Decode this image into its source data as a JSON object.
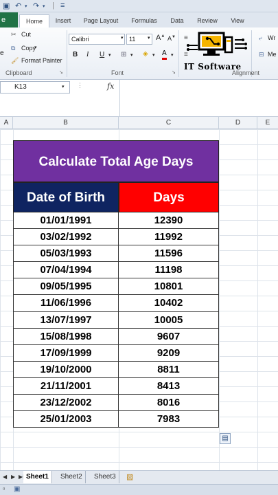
{
  "ribbon_tabs": {
    "file": "e",
    "home": "Home",
    "insert": "Insert",
    "page_layout": "Page Layout",
    "formulas": "Formulas",
    "data": "Data",
    "review": "Review",
    "view": "View"
  },
  "clipboard": {
    "cut": "Cut",
    "copy": "Copy",
    "format_painter": "Format Painter",
    "paste_partial": "e",
    "group_label": "Clipboard"
  },
  "font": {
    "family": "Calibri",
    "size": "11",
    "group_label": "Font",
    "bold": "B",
    "italic": "I",
    "underline": "U"
  },
  "alignment": {
    "wrap_partial": "Wr",
    "merge_partial": "Me",
    "group_label": "Alignment"
  },
  "logo": {
    "text": "IT Software"
  },
  "formula_bar": {
    "name_box": "K13",
    "fx": "fx"
  },
  "columns": [
    "A",
    "B",
    "C",
    "D",
    "E"
  ],
  "table": {
    "title": "Calculate Total Age Days",
    "header_dob": "Date of Birth",
    "header_days": "Days",
    "rows": [
      {
        "dob": "01/01/1991",
        "days": "12390"
      },
      {
        "dob": "03/02/1992",
        "days": "11992"
      },
      {
        "dob": "05/03/1993",
        "days": "11596"
      },
      {
        "dob": "07/04/1994",
        "days": "11198"
      },
      {
        "dob": "09/05/1995",
        "days": "10801"
      },
      {
        "dob": "11/06/1996",
        "days": "10402"
      },
      {
        "dob": "13/07/1997",
        "days": "10005"
      },
      {
        "dob": "15/08/1998",
        "days": "9607"
      },
      {
        "dob": "17/09/1999",
        "days": "9209"
      },
      {
        "dob": "19/10/2000",
        "days": "8811"
      },
      {
        "dob": "21/11/2001",
        "days": "8413"
      },
      {
        "dob": "23/12/2002",
        "days": "8016"
      },
      {
        "dob": "25/01/2003",
        "days": "7983"
      }
    ]
  },
  "sheets": [
    "Sheet1",
    "Sheet2",
    "Sheet3"
  ],
  "colors": {
    "title_bg": "#7030a0",
    "dob_header_bg": "#0f2461",
    "days_header_bg": "#ff0000",
    "file_tab": "#217346"
  }
}
